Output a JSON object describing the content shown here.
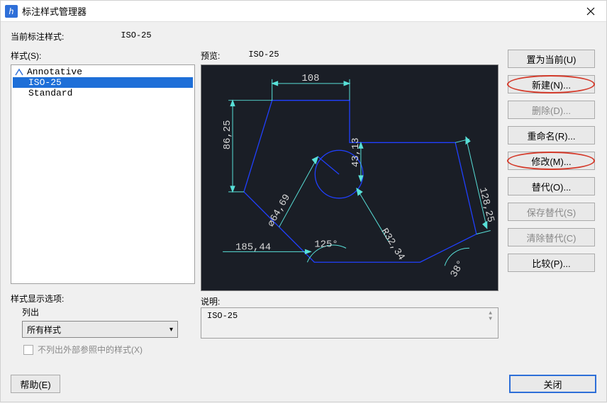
{
  "window": {
    "title": "标注样式管理器"
  },
  "labels": {
    "current_style_label": "当前标注样式:",
    "current_style_value": "ISO-25",
    "styles_label": "样式(S):",
    "preview_label": "预览:",
    "preview_value": "ISO-25",
    "desc_label": "说明:",
    "desc_value": "ISO-25",
    "display_options_label": "样式显示选项:",
    "list_label": "列出",
    "combo_value": "所有样式",
    "checkbox_label": "不列出外部参照中的样式(X)"
  },
  "styles_list": [
    {
      "name": "Annotative",
      "selected": false,
      "annotative": true
    },
    {
      "name": "ISO-25",
      "selected": true,
      "annotative": false
    },
    {
      "name": "Standard",
      "selected": false,
      "annotative": false
    }
  ],
  "buttons": {
    "set_current": "置为当前(U)",
    "new": "新建(N)...",
    "delete": "删除(D)...",
    "rename": "重命名(R)...",
    "modify": "修改(M)...",
    "override": "替代(O)...",
    "save_override": "保存替代(S)",
    "clear_override": "清除替代(C)",
    "compare": "比较(P)...",
    "help": "帮助(E)",
    "close": "关闭"
  },
  "preview_dims": {
    "d108": "108",
    "d8625": "86,25",
    "d4313": "43,13",
    "d12825": "128,25",
    "d6469": "⌀64,69",
    "r3234": "R32,34",
    "a125": "125°",
    "d18544": "185,44",
    "a38": "38°"
  }
}
